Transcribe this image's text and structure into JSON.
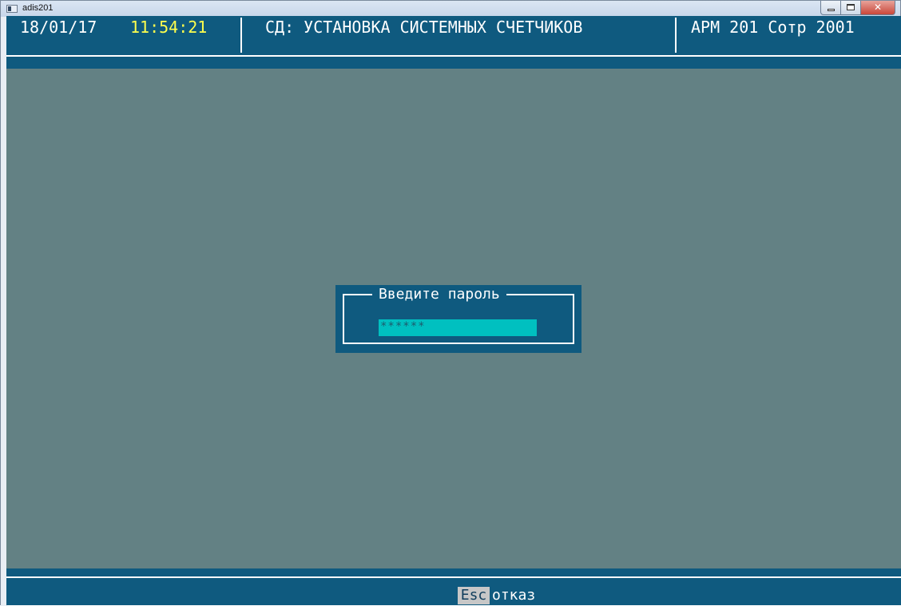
{
  "window": {
    "title": "adis201"
  },
  "header": {
    "date": "18/01/17",
    "time": "11:54:21",
    "title": "СД: УСТАНОВКА СИСТЕМНЫХ СЧЕТЧИКОВ",
    "user": "АРМ 201 Сотр 2001"
  },
  "dialog": {
    "title": "Введите пароль",
    "password_value": "******"
  },
  "footer": {
    "esc_key": "Esc",
    "esc_label": "отказ"
  },
  "colors": {
    "console_bg": "#638184",
    "panel_bg": "#0f5a7f",
    "time_color": "#ffff4d",
    "input_bg": "#00c0c0"
  },
  "icons": {
    "app": "console-app-icon",
    "minimize": "minimize-icon",
    "maximize": "maximize-icon",
    "close": "close-icon"
  }
}
